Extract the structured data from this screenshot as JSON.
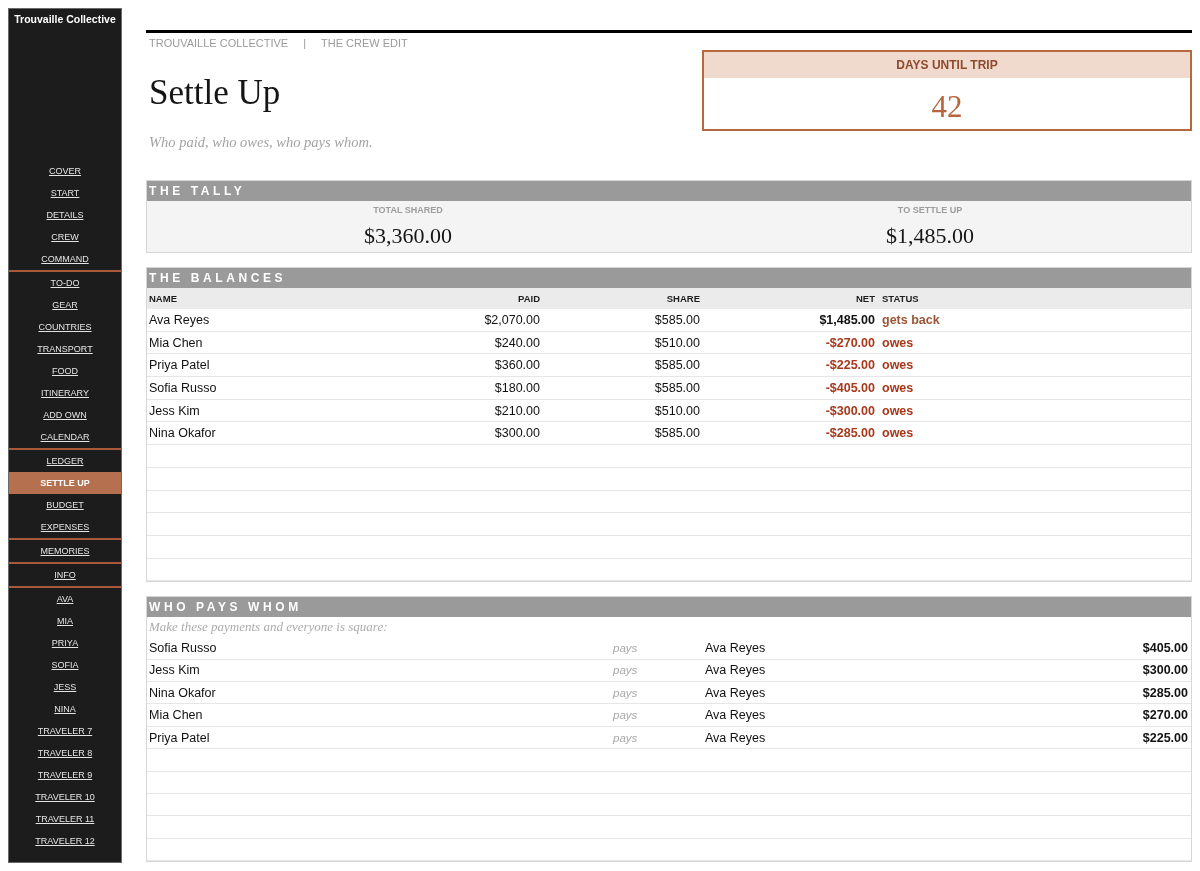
{
  "sidebar": {
    "title": "Trouvaille Collective",
    "groups": [
      {
        "items": [
          {
            "label": "COVER",
            "selected": false
          },
          {
            "label": "START",
            "selected": false
          },
          {
            "label": "DETAILS",
            "selected": false
          },
          {
            "label": "CREW",
            "selected": false
          },
          {
            "label": "COMMAND",
            "selected": false
          }
        ]
      },
      {
        "items": [
          {
            "label": "TO-DO",
            "selected": false
          },
          {
            "label": "GEAR",
            "selected": false
          },
          {
            "label": "COUNTRIES",
            "selected": false
          },
          {
            "label": "TRANSPORT",
            "selected": false
          },
          {
            "label": "FOOD",
            "selected": false
          },
          {
            "label": "ITINERARY",
            "selected": false
          },
          {
            "label": "ADD OWN",
            "selected": false
          },
          {
            "label": "CALENDAR",
            "selected": false
          }
        ]
      },
      {
        "items": [
          {
            "label": "LEDGER",
            "selected": false
          },
          {
            "label": "SETTLE UP",
            "selected": true
          },
          {
            "label": "BUDGET",
            "selected": false
          },
          {
            "label": "EXPENSES",
            "selected": false
          }
        ]
      },
      {
        "items": [
          {
            "label": "MEMORIES",
            "selected": false
          }
        ]
      },
      {
        "items": [
          {
            "label": "INFO",
            "selected": false
          }
        ]
      },
      {
        "items": [
          {
            "label": "AVA",
            "selected": false
          },
          {
            "label": "MIA",
            "selected": false
          },
          {
            "label": "PRIYA",
            "selected": false
          },
          {
            "label": "SOFIA",
            "selected": false
          },
          {
            "label": "JESS",
            "selected": false
          },
          {
            "label": "NINA",
            "selected": false
          },
          {
            "label": "TRAVELER 7",
            "selected": false
          },
          {
            "label": "TRAVELER 8",
            "selected": false
          },
          {
            "label": "TRAVELER 9",
            "selected": false
          },
          {
            "label": "TRAVELER 10",
            "selected": false
          },
          {
            "label": "TRAVELER 11",
            "selected": false
          },
          {
            "label": "TRAVELER 12",
            "selected": false
          }
        ]
      }
    ]
  },
  "header": {
    "breadcrumb": "TROUVAILLE COLLECTIVE",
    "separator": "|",
    "section": "THE CREW EDIT",
    "title": "Settle Up",
    "subtitle": "Who paid, who owes, who pays whom."
  },
  "countdown": {
    "label": "DAYS UNTIL TRIP",
    "value": "42"
  },
  "tally": {
    "title": "THE TALLY",
    "stats": [
      {
        "label": "TOTAL SHARED",
        "value": "$3,360.00"
      },
      {
        "label": "TO SETTLE UP",
        "value": "$1,485.00"
      }
    ]
  },
  "balances": {
    "title": "THE BALANCES",
    "columns": [
      "NAME",
      "PAID",
      "SHARE",
      "NET",
      "STATUS"
    ],
    "rows": [
      {
        "name": "Ava Reyes",
        "paid": "$2,070.00",
        "share": "$585.00",
        "net": "$1,485.00",
        "status": "gets back",
        "kind": "credit"
      },
      {
        "name": "Mia Chen",
        "paid": "$240.00",
        "share": "$510.00",
        "net": "-$270.00",
        "status": "owes",
        "kind": "debit"
      },
      {
        "name": "Priya Patel",
        "paid": "$360.00",
        "share": "$585.00",
        "net": "-$225.00",
        "status": "owes",
        "kind": "debit"
      },
      {
        "name": "Sofia Russo",
        "paid": "$180.00",
        "share": "$585.00",
        "net": "-$405.00",
        "status": "owes",
        "kind": "debit"
      },
      {
        "name": "Jess Kim",
        "paid": "$210.00",
        "share": "$510.00",
        "net": "-$300.00",
        "status": "owes",
        "kind": "debit"
      },
      {
        "name": "Nina Okafor",
        "paid": "$300.00",
        "share": "$585.00",
        "net": "-$285.00",
        "status": "owes",
        "kind": "debit"
      }
    ]
  },
  "payments": {
    "title": "WHO PAYS WHOM",
    "note": "Make these payments and everyone is square:",
    "rows": [
      {
        "from": "Sofia Russo",
        "verb": "pays",
        "to": "Ava Reyes",
        "amount": "$405.00"
      },
      {
        "from": "Jess Kim",
        "verb": "pays",
        "to": "Ava Reyes",
        "amount": "$300.00"
      },
      {
        "from": "Nina Okafor",
        "verb": "pays",
        "to": "Ava Reyes",
        "amount": "$285.00"
      },
      {
        "from": "Mia Chen",
        "verb": "pays",
        "to": "Ava Reyes",
        "amount": "$270.00"
      },
      {
        "from": "Priya Patel",
        "verb": "pays",
        "to": "Ava Reyes",
        "amount": "$225.00"
      }
    ]
  }
}
